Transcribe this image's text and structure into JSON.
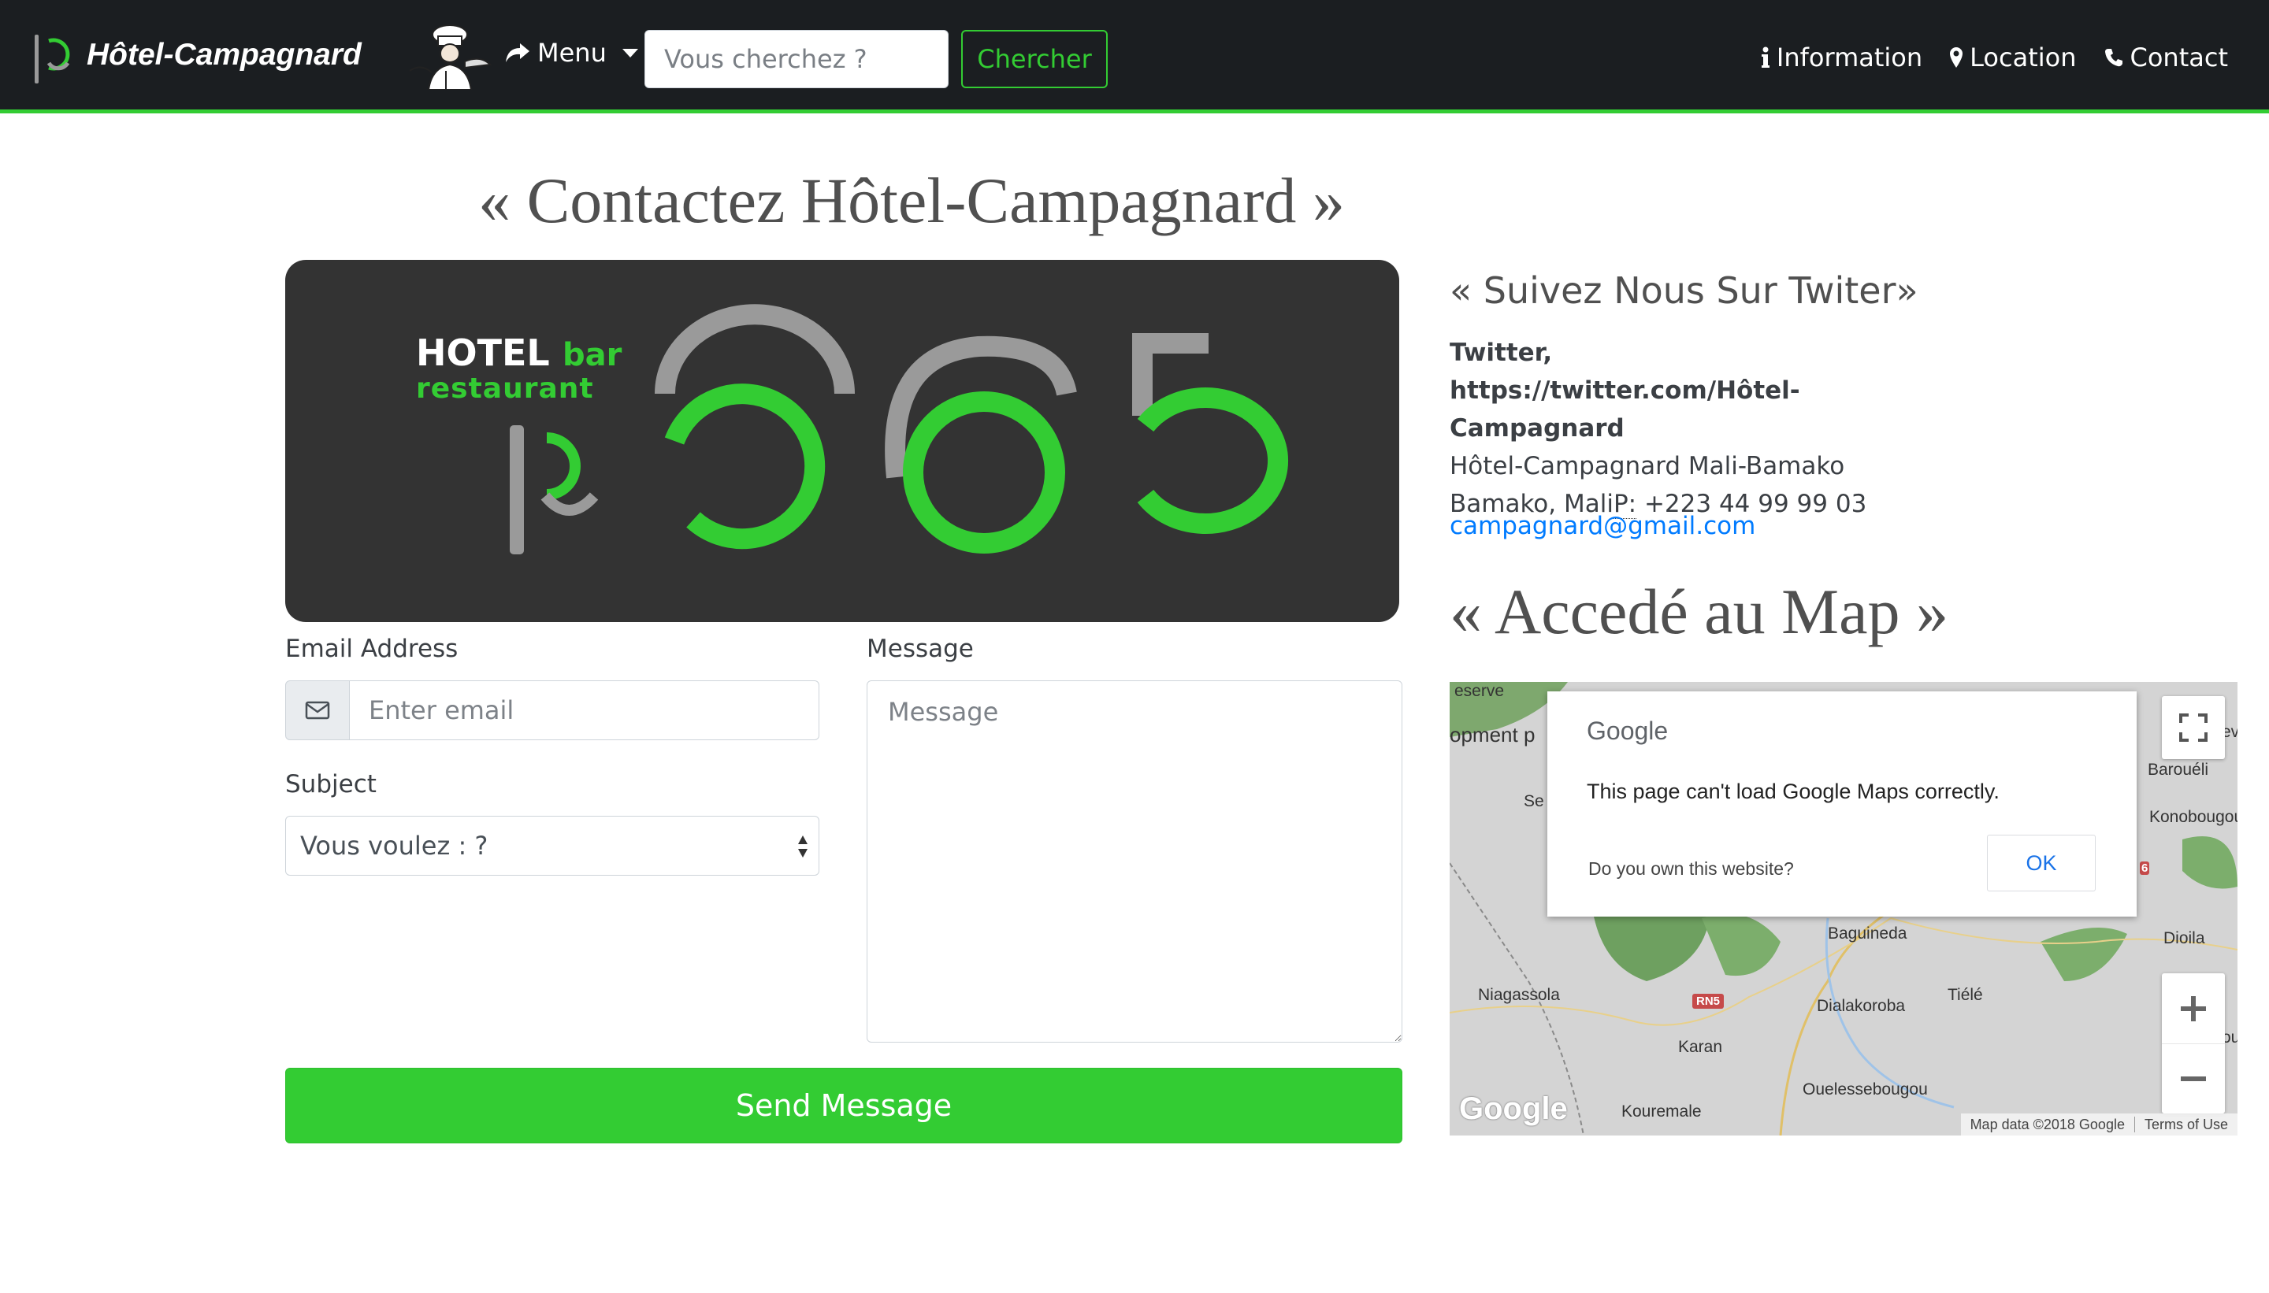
{
  "nav": {
    "brand": "Hôtel-Campagnard",
    "menu_label": "Menu",
    "search_placeholder": "Vous cherchez ?",
    "search_button": "Chercher",
    "links": [
      {
        "label": "Information",
        "icon": "info-icon"
      },
      {
        "label": "Location",
        "icon": "map-marker-icon"
      },
      {
        "label": "Contact",
        "icon": "phone-icon"
      }
    ]
  },
  "page": {
    "title": "« Contactez Hôtel-Campagnard »"
  },
  "hero": {
    "line1": "HOTEL",
    "line1_accent": "bar",
    "line2": "restaurant",
    "number": "365"
  },
  "form": {
    "email_label": "Email Address",
    "email_placeholder": "Enter email",
    "subject_label": "Subject",
    "subject_value": "Vous voulez : ?",
    "message_label": "Message",
    "message_placeholder": "Message",
    "send_button": "Send Message"
  },
  "sidebar": {
    "twitter_heading": "« Suivez Nous Sur Twiter»",
    "twitter_text": "Twitter, https://twitter.com/Hôtel-Campagnard",
    "address_line1": "Hôtel-Campagnard Mali-Bamako",
    "address_line2": "Bamako, Mali",
    "phone_abbr": "P:",
    "phone": "+223 44 99 99 03",
    "email": "campagnard@gmail.com",
    "map_title": "« Accedé au Map »"
  },
  "map": {
    "dialog_logo": "Google",
    "dialog_message": "This page can't load Google Maps correctly.",
    "dialog_question": "Do you own this website?",
    "dialog_ok": "OK",
    "google_logo": "Google",
    "attribution": "Map data ©2018 Google",
    "terms": "Terms of Use",
    "places": [
      "Baguineda",
      "Niagassola",
      "Dialakoroba",
      "Tiélé",
      "Karan",
      "Ouelessebougou",
      "Kouremale",
      "Dioila",
      "Barouéli",
      "Konobougou"
    ],
    "road": "RN5",
    "cut_labels": {
      "top_left": "eserve",
      "dev": "opment p",
      "se": "Se",
      "right_edge": "ev",
      "right_pu": "ou",
      "badge": "6"
    }
  },
  "colors": {
    "accent": "#33cc33",
    "navbar": "#1b1e21",
    "hero_bg": "#333333",
    "link": "#007bff"
  }
}
